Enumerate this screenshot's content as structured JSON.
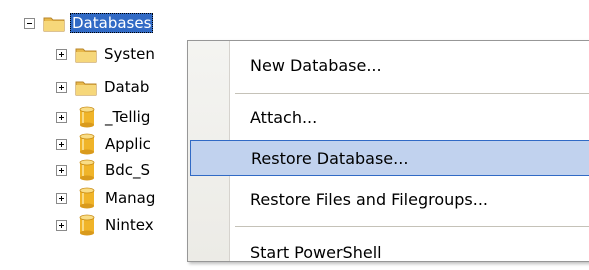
{
  "tree": {
    "root": {
      "label": "Databases",
      "expander": "minus",
      "icon": "folder-icon"
    },
    "children": [
      {
        "label": "Systen",
        "icon": "folder-icon"
      },
      {
        "label": "Datab",
        "icon": "folder-icon"
      },
      {
        "label": "_Tellig",
        "icon": "database-icon"
      },
      {
        "label": "Applic",
        "icon": "database-icon"
      },
      {
        "label": "Bdc_S",
        "icon": "database-icon"
      },
      {
        "label": "Manag",
        "icon": "database-icon"
      },
      {
        "label": "Nintex",
        "icon": "database-icon"
      }
    ]
  },
  "context_menu": {
    "items": [
      {
        "label": "New Database..."
      },
      {
        "label": "Attach..."
      },
      {
        "label": "Restore Database...",
        "highlighted": true
      },
      {
        "label": "Restore Files and Filegroups..."
      },
      {
        "label": "Start PowerShell"
      }
    ]
  },
  "colors": {
    "selection": "#316ac5",
    "menu_hover": "#c1d2ee",
    "folder": "#f2c94c",
    "database": "#f0b429"
  }
}
